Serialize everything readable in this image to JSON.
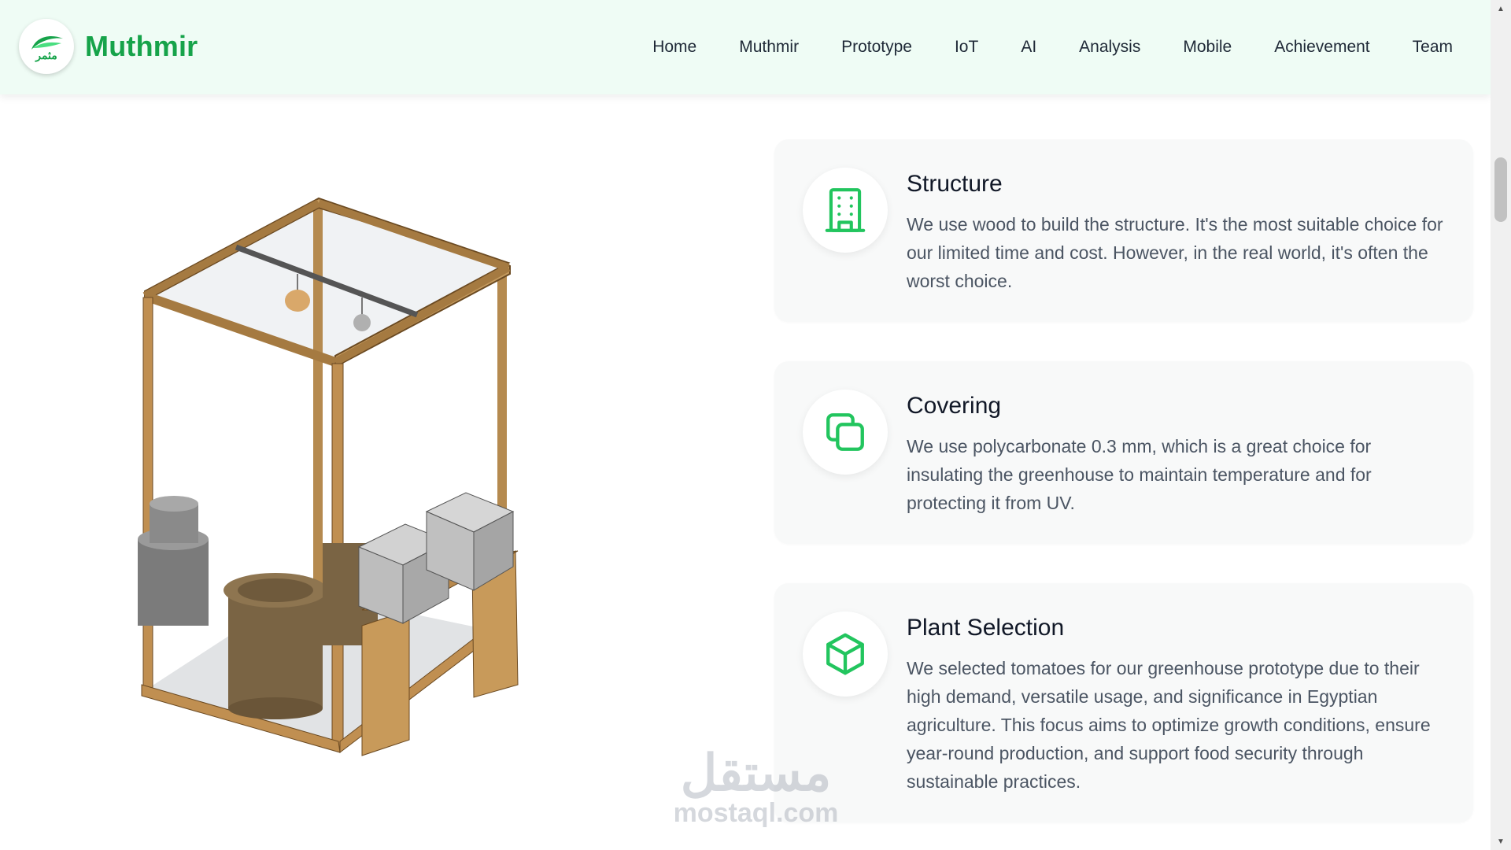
{
  "brand": {
    "name": "Muthmir",
    "logo_text": "مثمر",
    "logo_icon": "leaf-icon"
  },
  "nav": {
    "items": [
      {
        "label": "Home"
      },
      {
        "label": "Muthmir"
      },
      {
        "label": "Prototype"
      },
      {
        "label": "IoT"
      },
      {
        "label": "AI"
      },
      {
        "label": "Analysis"
      },
      {
        "label": "Mobile"
      },
      {
        "label": "Achievement"
      },
      {
        "label": "Team"
      }
    ]
  },
  "features": [
    {
      "icon": "building-icon",
      "title": "Structure",
      "text": "We use wood to build the structure. It's the most suitable choice for our limited time and cost. However, in the real world, it's often the worst choice."
    },
    {
      "icon": "layers-copy-icon",
      "title": "Covering",
      "text": "We use polycarbonate 0.3 mm, which is a great choice for insulating the greenhouse to maintain temperature and for protecting it from UV."
    },
    {
      "icon": "cube-icon",
      "title": "Plant Selection",
      "text": "We selected tomatoes for our greenhouse prototype due to their high demand, versatile usage, and significance in Egyptian agriculture. This focus aims to optimize growth conditions, ensure year-round production, and support food security through sustainable practices."
    }
  ],
  "watermark": {
    "arabic": "مستقل",
    "latin": "mostaql.com"
  },
  "colors": {
    "accent": "#16a34a",
    "navbar_bg": "#effcf5",
    "card_bg": "#f8f9f9"
  }
}
